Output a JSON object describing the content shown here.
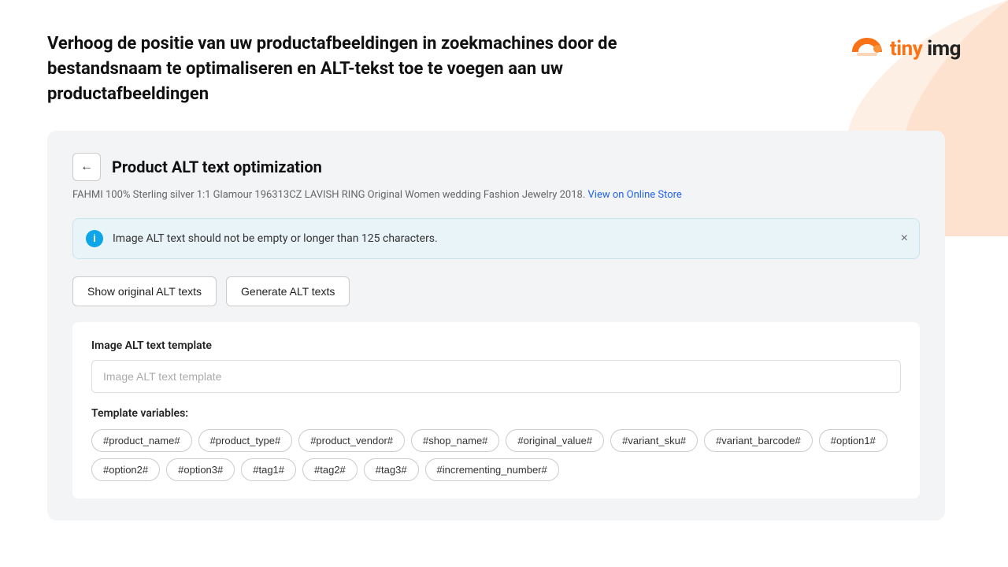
{
  "logo": {
    "text_plain": "tiny img",
    "text_bold": "tiny",
    "text_light": " img"
  },
  "headline": "Verhoog de positie van uw productafbeeldingen in zoekmachines door de bestandsnaam te optimaliseren en ALT-tekst toe te voegen aan uw productafbeeldingen",
  "card": {
    "title": "Product ALT text optimization",
    "back_label": "←",
    "product_description": "FAHMI 100% Sterling silver 1:1 Glamour 196313CZ LAVISH RING Original Women wedding Fashion Jewelry 2018.",
    "view_store_link": "View on Online Store",
    "info_message": "Image ALT text should not be empty or longer than 125 characters.",
    "close_label": "×"
  },
  "buttons": {
    "show_original": "Show original ALT texts",
    "generate": "Generate ALT texts"
  },
  "template_section": {
    "label": "Image ALT text template",
    "input_placeholder": "Image ALT text template",
    "variables_label": "Template variables:",
    "variables": [
      "#product_name#",
      "#product_type#",
      "#product_vendor#",
      "#shop_name#",
      "#original_value#",
      "#variant_sku#",
      "#variant_barcode#",
      "#option1#",
      "#option2#",
      "#option3#",
      "#tag1#",
      "#tag2#",
      "#tag3#",
      "#incrementing_number#"
    ]
  }
}
